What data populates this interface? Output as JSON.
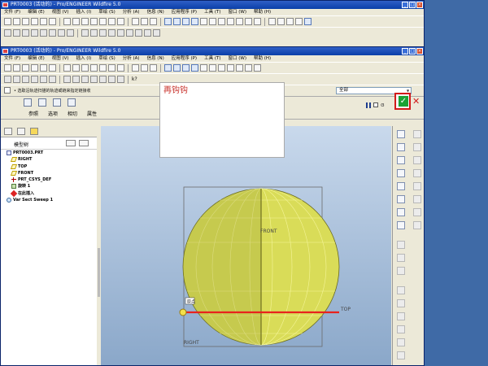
{
  "window_back": {
    "title": "PRT0003 (活动的) - Pro/ENGINEER Wildfire 5.0",
    "menu": [
      "文件 (F)",
      "编辑 (E)",
      "视图 (V)",
      "插入 (I)",
      "草绘 (S)",
      "分析 (A)",
      "信息 (N)",
      "应用程序 (P)",
      "工具 (T)",
      "窗口 (W)",
      "帮助 (H)"
    ]
  },
  "window_front": {
    "title": "PRT0003 (活动的) - Pro/ENGINEER Wildfire 5.0",
    "menu": [
      "文件 (F)",
      "编辑 (E)",
      "视图 (V)",
      "插入 (I)",
      "草绘 (S)",
      "分析 (A)",
      "信息 (N)",
      "应用程序 (P)",
      "工具 (T)",
      "窗口 (W)",
      "帮助 (H)"
    ]
  },
  "toolbar": {
    "help_label": "k?"
  },
  "dashboard": {
    "message": "• 选取沿轨迹扫描的轨迹或链来指定链接收",
    "filter_value": "全部",
    "tabs": [
      "参照",
      "选项",
      "相切",
      "属性"
    ]
  },
  "model_tree": {
    "header": "模型树",
    "items": [
      {
        "label": "PRT0003.PRT",
        "icon": "part-icon",
        "level": 0
      },
      {
        "label": "RIGHT",
        "icon": "datum-plane-icon",
        "level": 1
      },
      {
        "label": "TOP",
        "icon": "datum-plane-icon",
        "level": 1
      },
      {
        "label": "FRONT",
        "icon": "datum-plane-icon",
        "level": 1
      },
      {
        "label": "PRT_CSYS_DEF",
        "icon": "csys-icon",
        "level": 1
      },
      {
        "label": "旋转 1",
        "icon": "revolve-icon",
        "level": 1
      },
      {
        "label": "在此插入",
        "icon": "insert-here-icon",
        "level": 1
      },
      {
        "label": "Var Sect Sweep 1",
        "icon": "sweep-icon",
        "level": 1
      }
    ]
  },
  "viewport": {
    "front_label": "FRONT",
    "top_label": "TOP",
    "right_label": "RIGHT",
    "origin_label": "原点",
    "trajectory_color": "#e8231d",
    "sphere_color": "#d9dc58"
  },
  "popup": {
    "text": "再钩钩"
  },
  "colors": {
    "accent_ok": "#19a234",
    "highlight": "#d21a1a"
  }
}
